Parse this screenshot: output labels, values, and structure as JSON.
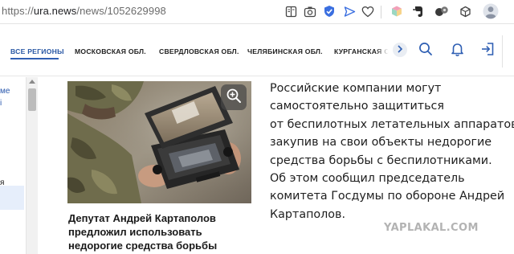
{
  "browser": {
    "url_scheme": "https://",
    "url_host": "ura.news",
    "url_path": "/news/1052629998",
    "toolbar_icons": [
      "reader-mode-icon",
      "screenshot-icon",
      "shield-check-icon",
      "send-icon",
      "heart-icon",
      "extension-icon",
      "evernote-icon",
      "extension-icon",
      "puzzle-icon",
      "profile-avatar-icon"
    ],
    "accent_color": "#3b6fe0"
  },
  "nav": {
    "items": [
      {
        "label": "ВСЕ РЕГИОНЫ",
        "active": true
      },
      {
        "label": "МОСКОВСКАЯ ОБЛ."
      },
      {
        "label": "СВЕРДЛОВСКАЯ ОБЛ."
      },
      {
        "label": "ЧЕЛЯБИНСКАЯ ОБЛ."
      },
      {
        "label": "КУРГАНСКАЯ ОБЛ."
      }
    ],
    "icons": [
      "chevron-right-icon",
      "search-icon",
      "bell-icon",
      "login-icon"
    ],
    "accent_color": "#2f5fb3"
  },
  "sidebar": {
    "line1": "ме",
    "line2": "i",
    "line3": "я"
  },
  "article": {
    "caption_lines": [
      "Депутат Андрей Картаполов",
      "предложил использовать",
      "недорогие средства борьбы"
    ],
    "body_lines": [
      "Российские компании могут",
      "самостоятельно защититься",
      "от беспилотных летательных аппаратов,",
      "закупив на свои объекты недорогие",
      "средства борьбы с беспилотниками.",
      "Об этом сообщил председатель",
      "комитета Госдумы по обороне Андрей",
      "Картаполов."
    ]
  },
  "watermark": "YAPLAKAL.COM"
}
